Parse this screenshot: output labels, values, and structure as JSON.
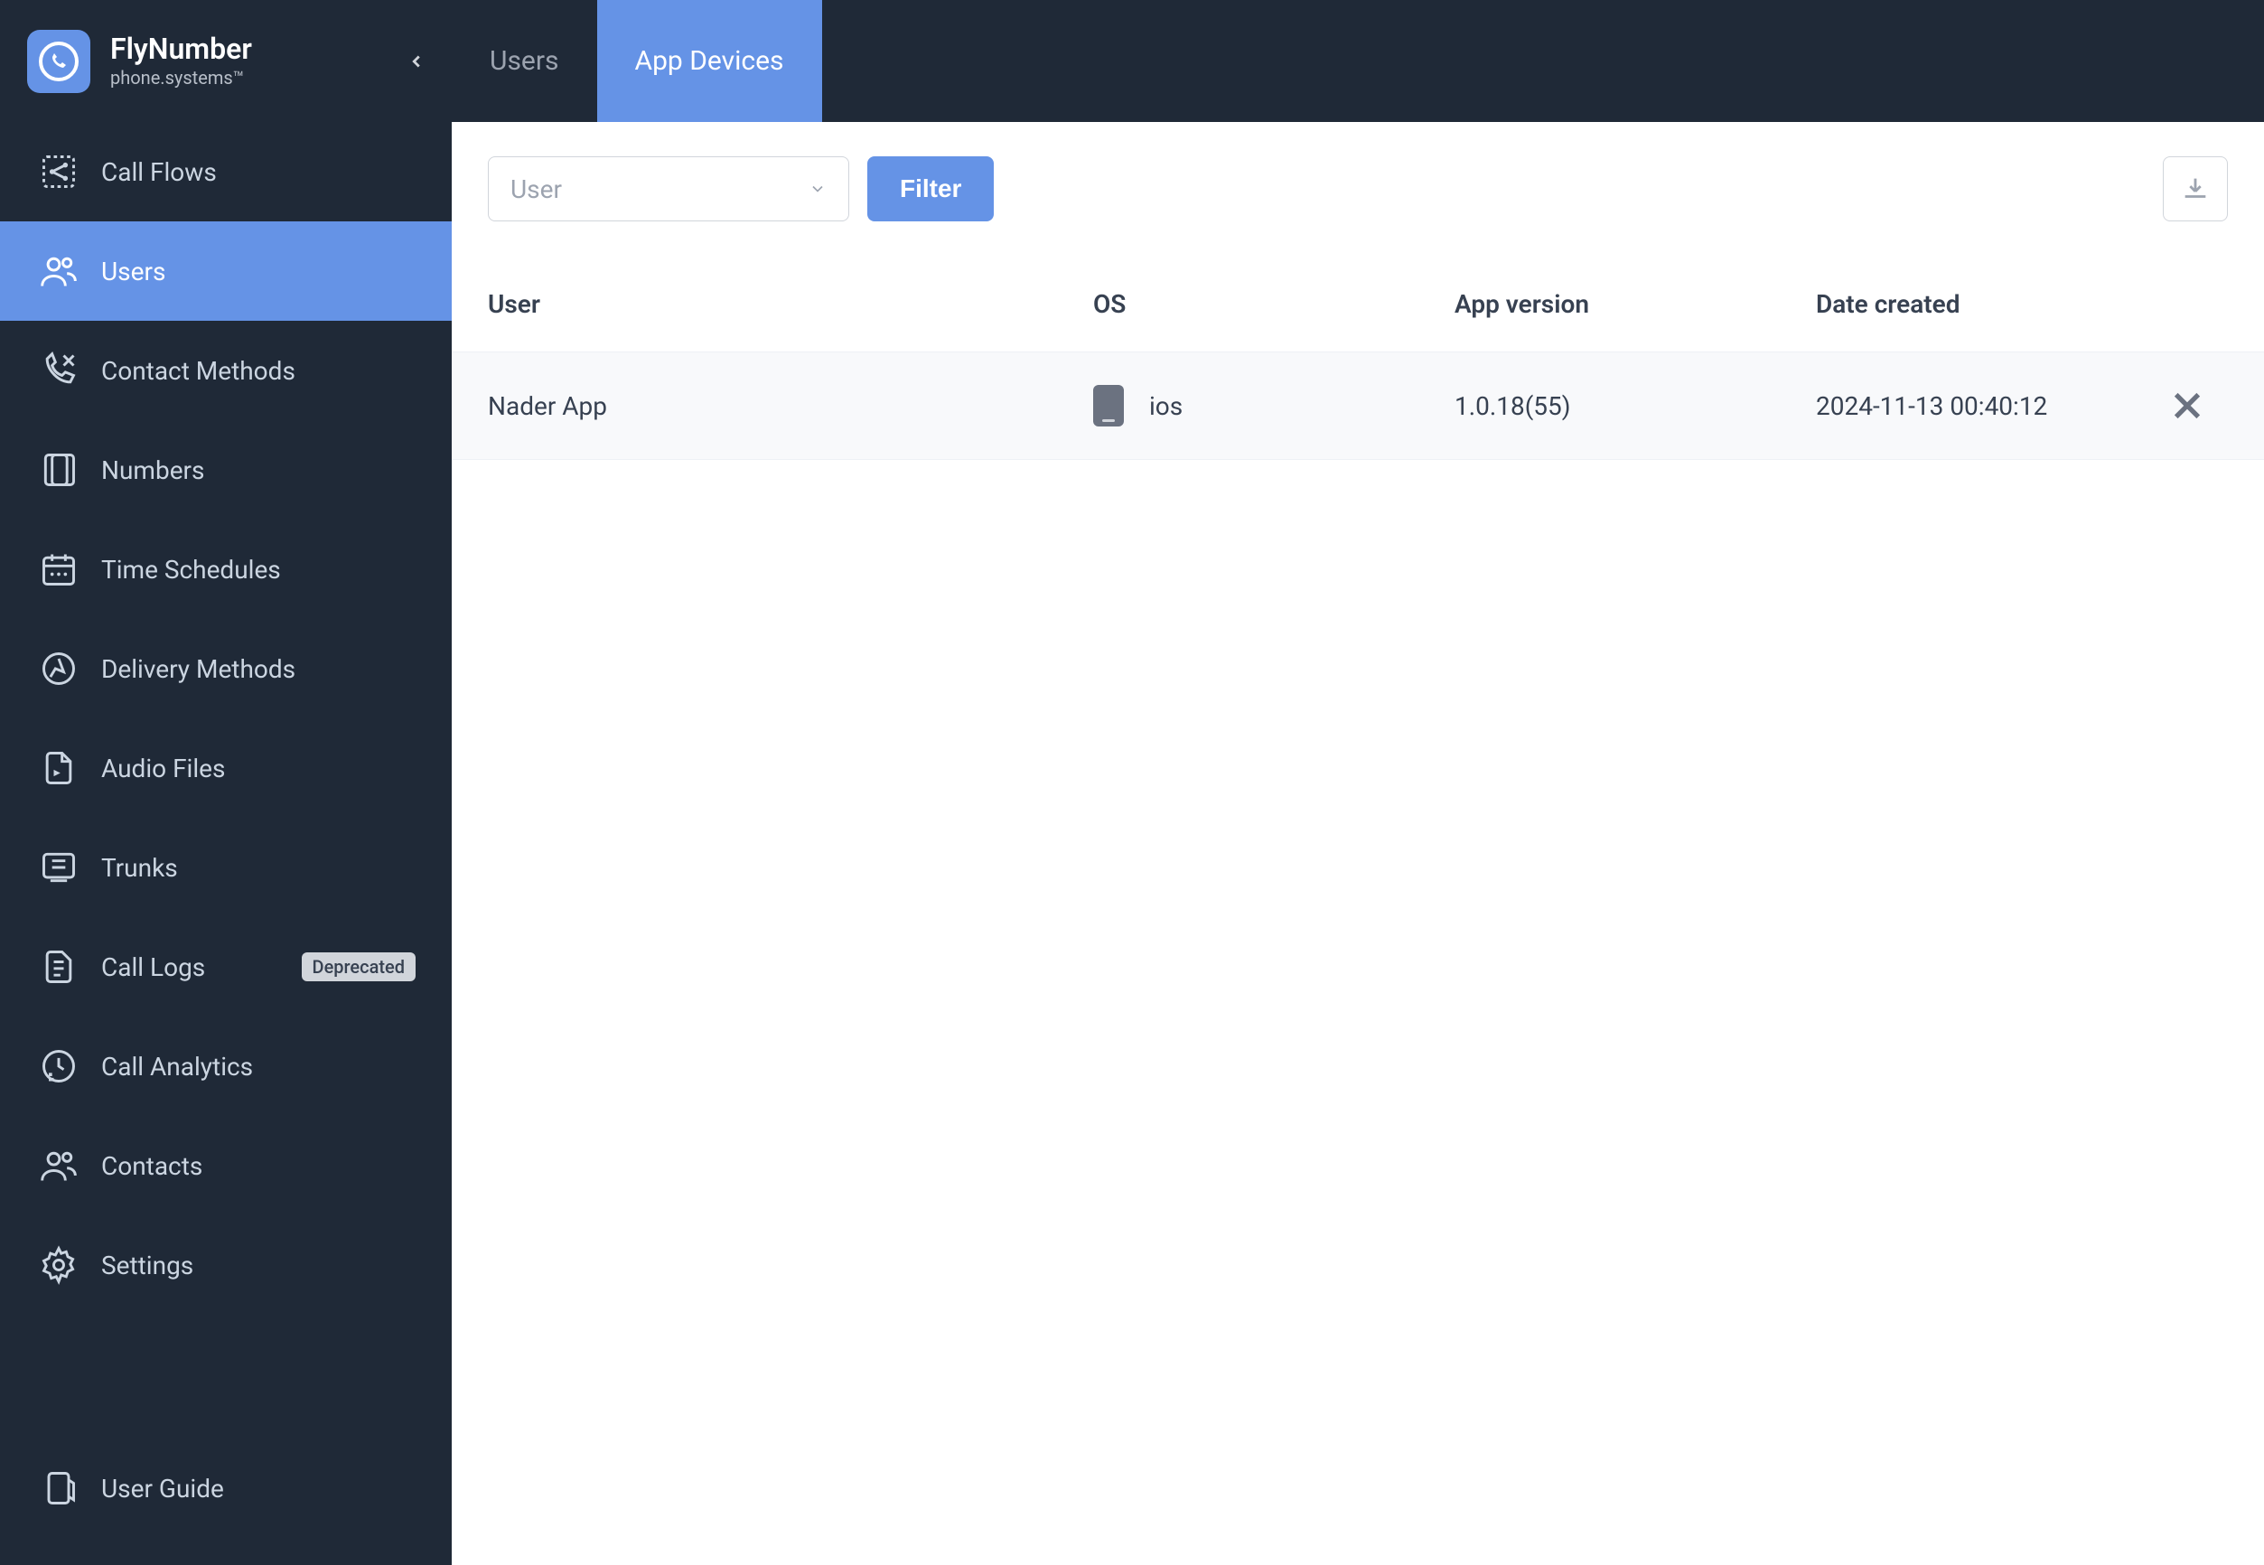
{
  "brand": {
    "title": "FlyNumber",
    "subtitle": "phone.systems™"
  },
  "sidebar": {
    "items": [
      {
        "label": "Call Flows"
      },
      {
        "label": "Users"
      },
      {
        "label": "Contact Methods"
      },
      {
        "label": "Numbers"
      },
      {
        "label": "Time Schedules"
      },
      {
        "label": "Delivery Methods"
      },
      {
        "label": "Audio Files"
      },
      {
        "label": "Trunks"
      },
      {
        "label": "Call Logs",
        "badge": "Deprecated"
      },
      {
        "label": "Call Analytics"
      },
      {
        "label": "Contacts"
      },
      {
        "label": "Settings"
      }
    ],
    "bottom": {
      "label": "User Guide"
    }
  },
  "tabs": [
    {
      "label": "Users"
    },
    {
      "label": "App Devices"
    }
  ],
  "filter": {
    "select_placeholder": "User",
    "button": "Filter"
  },
  "table": {
    "headers": {
      "user": "User",
      "os": "OS",
      "version": "App version",
      "date": "Date created"
    },
    "rows": [
      {
        "user": "Nader App",
        "os": "ios",
        "version": "1.0.18(55)",
        "date": "2024-11-13 00:40:12"
      }
    ]
  }
}
